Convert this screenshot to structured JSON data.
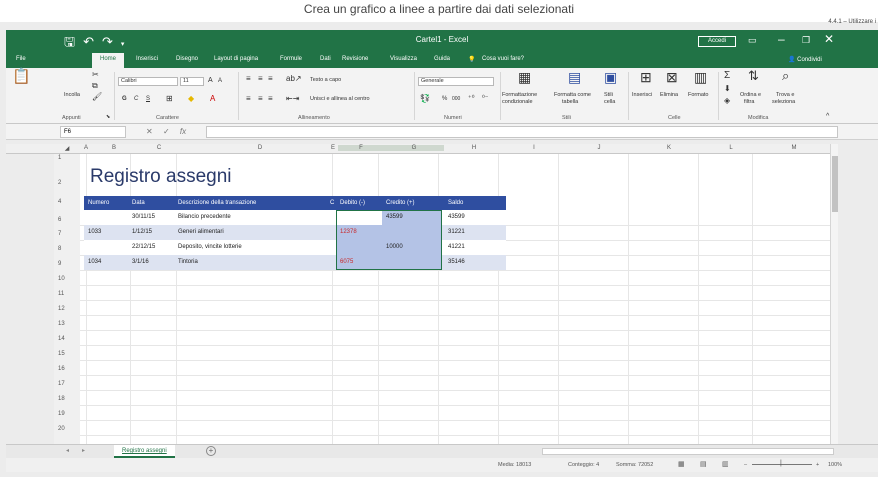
{
  "caption": "Crea un grafico a linee a partire dai dati selezionati",
  "corner_text": "4.4.1 – Utilizzare i",
  "window": {
    "title": "Cartel1 - Excel",
    "signin": "Accedi",
    "qat_icons": [
      "save-icon",
      "undo-icon",
      "redo-icon"
    ],
    "ribbon_display_icon": "ribbon-display-options-icon",
    "minimize_icon": "minimize-icon",
    "restore_icon": "restore-icon",
    "close_icon": "close-icon"
  },
  "tabs": [
    "File",
    "Home",
    "Inserisci",
    "Disegno",
    "Layout di pagina",
    "Formule",
    "Dati",
    "Revisione",
    "Visualizza",
    "Guida"
  ],
  "active_tab": "Home",
  "tell_me": "Cosa vuoi fare?",
  "share": "Condividi",
  "ribbon": {
    "clipboard": {
      "paste": "Incolla",
      "label": "Appunti"
    },
    "font": {
      "name": "Calibri",
      "size": "11",
      "grow": "A",
      "shrink": "A",
      "bold": "G",
      "italic": "C",
      "underline": "S",
      "label": "Carattere"
    },
    "alignment": {
      "wrap": "Testo a capo",
      "merge": "Unisci e allinea al centro",
      "label": "Allineamento"
    },
    "number": {
      "format": "Generale",
      "percent": "%",
      "thousands": "000",
      "label": "Numeri"
    },
    "styles": {
      "conditional_line1": "Formattazione",
      "conditional_line2": "condizionale",
      "table_line1": "Formatta come",
      "table_line2": "tabella",
      "cell_line1": "Stili",
      "cell_line2": "cella",
      "label": "Stili"
    },
    "cells": {
      "insert": "Inserisci",
      "delete": "Elimina",
      "format": "Formato",
      "label": "Celle"
    },
    "editing": {
      "sum": "Σ",
      "sort_line1": "Ordina e",
      "sort_line2": "filtra",
      "find_line1": "Trova e",
      "find_line2": "seleziona",
      "label": "Modifica"
    }
  },
  "formula_bar": {
    "name_box": "F6",
    "cancel": "✕",
    "enter": "✓",
    "fx": "fx",
    "value": ""
  },
  "columns": [
    "A",
    "B",
    "C",
    "D",
    "E",
    "F",
    "G",
    "H",
    "I",
    "J",
    "K",
    "L",
    "M"
  ],
  "rows": [
    "1",
    "2",
    "4",
    "6",
    "7",
    "8",
    "9",
    "10",
    "11",
    "12",
    "13",
    "14",
    "15",
    "16",
    "17",
    "18",
    "19",
    "20"
  ],
  "sheet_title": "Registro assegni",
  "table": {
    "headers": [
      "Numero",
      "Data",
      "Descrizione della transazione",
      "C",
      "Debito (-)",
      "Credito (+)",
      "Saldo"
    ],
    "rows": [
      {
        "numero": "",
        "data": "30/11/15",
        "descrizione": "Bilancio precedente",
        "debito": "",
        "credito": "43599",
        "saldo": "43599"
      },
      {
        "numero": "1033",
        "data": "1/12/15",
        "descrizione": "Generi alimentari",
        "debito": "12378",
        "credito": "",
        "saldo": "31221"
      },
      {
        "numero": "",
        "data": "22/12/15",
        "descrizione": "Deposito, vincite lotterie",
        "debito": "",
        "credito": "10000",
        "saldo": "41221"
      },
      {
        "numero": "1034",
        "data": "3/1/16",
        "descrizione": "Tintoria",
        "debito": "6075",
        "credito": "",
        "saldo": "35146"
      }
    ]
  },
  "sheet_tab": "Registro assegni",
  "status": {
    "average": "Media: 18013",
    "count": "Conteggio: 4",
    "sum": "Somma: 72052",
    "zoom": "100%"
  },
  "colors": {
    "excel_green": "#217346",
    "table_header": "#2f4ea0",
    "band": "#dde3f1",
    "selection": "#b4c3e6",
    "debit_red": "#c8282a"
  }
}
